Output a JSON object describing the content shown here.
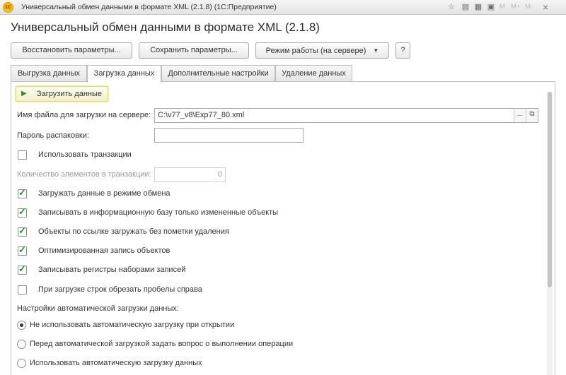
{
  "window": {
    "title": "Универсальный обмен данными в формате XML (2.1.8)  (1С:Предприятие)",
    "logo": "1C",
    "controls": [
      "star-icon",
      "doc-icon",
      "calc-icon",
      "calendar-icon"
    ],
    "m_buttons": [
      "M",
      "M+",
      "M-"
    ],
    "close_glyph": "×"
  },
  "form": {
    "title": "Универсальный обмен данными в формате XML (2.1.8)"
  },
  "toolbar": {
    "restore_label": "Восстановить параметры...",
    "save_label": "Сохранить параметры...",
    "mode_label": "Режим работы (на сервере)",
    "help_label": "?"
  },
  "tabs": [
    {
      "label": "Выгрузка данных",
      "active": false
    },
    {
      "label": "Загрузка данных",
      "active": true
    },
    {
      "label": "Дополнительные настройки",
      "active": false
    },
    {
      "label": "Удаление данных",
      "active": false
    }
  ],
  "load": {
    "button_label": "Загрузить данные",
    "file_label": "Имя файла для загрузки на сервере:",
    "file_value": "C:\\v77_v8\\Exp77_80.xml",
    "select_glyph": "...",
    "open_glyph": "⧉",
    "password_label": "Пароль распаковки:",
    "password_value": "",
    "transactions_label": "Использовать транзакции",
    "transactions_checked": false,
    "count_label": "Количество элементов в транзакции:",
    "count_value": "0",
    "options": [
      {
        "label": "Загружать данные в режиме обмена",
        "checked": true
      },
      {
        "label": "Записывать в информационную базу только измененные объекты",
        "checked": true
      },
      {
        "label": "Объекты по ссылке загружать без пометки удаления",
        "checked": true
      },
      {
        "label": "Оптимизированная запись объектов",
        "checked": true
      },
      {
        "label": "Записывать регистры наборами записей",
        "checked": true
      },
      {
        "label": "При загрузке строк обрезать пробелы справа",
        "checked": false
      }
    ],
    "auto_label": "Настройки автоматической загрузки данных:",
    "auto_options": [
      {
        "label": "Не использовать автоматическую загрузку при открытии",
        "selected": true
      },
      {
        "label": "Перед автоматической загрузкой задать вопрос о выполнении операции",
        "selected": false
      },
      {
        "label": "Использовать автоматическую загрузку данных",
        "selected": false
      }
    ]
  }
}
